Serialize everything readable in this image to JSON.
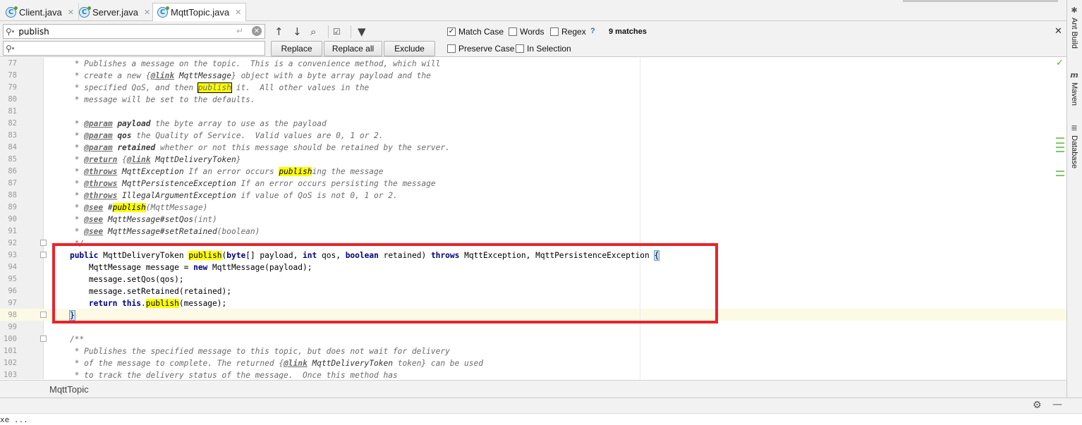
{
  "tabs": [
    {
      "label": "Client.java",
      "active": false
    },
    {
      "label": "Server.java",
      "active": false
    },
    {
      "label": "MqttTopic.java",
      "active": true
    }
  ],
  "find": {
    "search_value": "publish",
    "replace_value": "",
    "replace_label": "Replace",
    "replace_all_label": "Replace all",
    "exclude_label": "Exclude",
    "match_case_label": "Match Case",
    "words_label": "Words",
    "regex_label": "Regex",
    "help_label": "?",
    "matches_label": "9 matches",
    "preserve_case_label": "Preserve Case",
    "in_selection_label": "In Selection",
    "match_case_checked": true,
    "words_checked": false,
    "regex_checked": false,
    "preserve_case_checked": false,
    "in_selection_checked": false
  },
  "code_lines": [
    {
      "n": "77",
      "html": "<span class=\"cm\">     * Publishes a message on the topic.  This is a convenience method, which will</span>"
    },
    {
      "n": "78",
      "html": "<span class=\"cm\">     * create a new {</span><span class=\"tg\">@link</span><span class=\"ref\"> MqttMessage</span><span class=\"cm\">} object with a byte array payload and the</span>"
    },
    {
      "n": "79",
      "html": "<span class=\"cm\">     * specified QoS, and then </span><span class=\"hlb cm\">publish</span><span class=\"cm\"> it.  All other values in the</span>"
    },
    {
      "n": "80",
      "html": "<span class=\"cm\">     * message will be set to the defaults.</span>"
    },
    {
      "n": "81",
      "html": ""
    },
    {
      "n": "82",
      "html": "<span class=\"cm\">     * </span><span class=\"tg\">@param</span><span class=\"pn\"> payload</span><span class=\"cm\"> the byte array to use as the payload</span>"
    },
    {
      "n": "83",
      "html": "<span class=\"cm\">     * </span><span class=\"tg\">@param</span><span class=\"pn\"> qos</span><span class=\"cm\"> the Quality of Service.  Valid values are 0, 1 or 2.</span>"
    },
    {
      "n": "84",
      "html": "<span class=\"cm\">     * </span><span class=\"tg\">@param</span><span class=\"pn\"> retained</span><span class=\"cm\"> whether or not this message should be retained by the server.</span>"
    },
    {
      "n": "85",
      "html": "<span class=\"cm\">     * </span><span class=\"tg\">@return</span><span class=\"cm\"> {</span><span class=\"tg\">@link</span><span class=\"ref\"> MqttDeliveryToken</span><span class=\"cm\">}</span>"
    },
    {
      "n": "86",
      "html": "<span class=\"cm\">     * </span><span class=\"tg\">@throws</span><span class=\"ref\"> MqttException</span><span class=\"cm\"> If an error occurs </span><span class=\"hl cm\">publish</span><span class=\"cm\">ing the message</span>"
    },
    {
      "n": "87",
      "html": "<span class=\"cm\">     * </span><span class=\"tg\">@throws</span><span class=\"ref\"> MqttPersistenceException</span><span class=\"cm\"> If an error occurs persisting the message</span>"
    },
    {
      "n": "88",
      "html": "<span class=\"cm\">     * </span><span class=\"tg\">@throws</span><span class=\"ref\"> IllegalArgumentException</span><span class=\"cm\"> if value of QoS is not 0, 1 or 2.</span>"
    },
    {
      "n": "89",
      "html": "<span class=\"cm\">     * </span><span class=\"tg\">@see</span><span class=\"ref\"> #</span><span class=\"hl ref\">publish</span><span class=\"cm\">(MqttMessage)</span>"
    },
    {
      "n": "90",
      "html": "<span class=\"cm\">     * </span><span class=\"tg\">@see</span><span class=\"ref\"> MqttMessage#setQos</span><span class=\"cm\">(int)</span>"
    },
    {
      "n": "91",
      "html": "<span class=\"cm\">     * </span><span class=\"tg\">@see</span><span class=\"ref\"> MqttMessage#setRetained</span><span class=\"cm\">(boolean)</span>"
    },
    {
      "n": "92",
      "html": "<span class=\"cm\">     */</span>"
    },
    {
      "n": "93",
      "html": "    <span class=\"kw\">public</span> MqttDeliveryToken <span class=\"hl\">publish</span>(<span class=\"kw\">byte</span>[] payload, <span class=\"kw\">int</span> qos, <span class=\"kw\">boolean</span> retained) <span class=\"kw\">throws</span> MqttException, MqttPersistenceException <span class=\"bm\">{</span>"
    },
    {
      "n": "94",
      "html": "        MqttMessage message = <span class=\"kw\">new</span> MqttMessage(payload);"
    },
    {
      "n": "95",
      "html": "        message.setQos(qos);"
    },
    {
      "n": "96",
      "html": "        message.setRetained(retained);"
    },
    {
      "n": "97",
      "html": "        <span class=\"kw\">return this</span>.<span class=\"hl\">publish</span>(message);"
    },
    {
      "n": "98",
      "html": "    <span class=\"bm\">}</span>"
    },
    {
      "n": "99",
      "html": ""
    },
    {
      "n": "100",
      "html": "<span class=\"cm\">    /**</span>"
    },
    {
      "n": "101",
      "html": "<span class=\"cm\">     * Publishes the specified message to this topic, but does not wait for delivery</span>"
    },
    {
      "n": "102",
      "html": "<span class=\"cm\">     * of the message to complete. The returned {</span><span class=\"tg\">@link</span><span class=\"ref\"> MqttDeliveryToken</span><span class=\"cm\"> token} can be used</span>"
    },
    {
      "n": "103",
      "html": "<span class=\"cm\">     * to track the delivery status of the message.  Once this method has</span>"
    }
  ],
  "breadcrumb": "MqttTopic",
  "status_text": "xe ...",
  "tool_windows": [
    {
      "label": "Ant Build",
      "icon": "ant-icon"
    },
    {
      "label": "Maven",
      "icon": "maven-icon"
    },
    {
      "label": "Database",
      "icon": "database-icon"
    }
  ],
  "colors": {
    "highlight": "#ffff00",
    "annotation_box": "#e8242b",
    "keyword": "#000080",
    "current_line": "#fcfae5"
  }
}
